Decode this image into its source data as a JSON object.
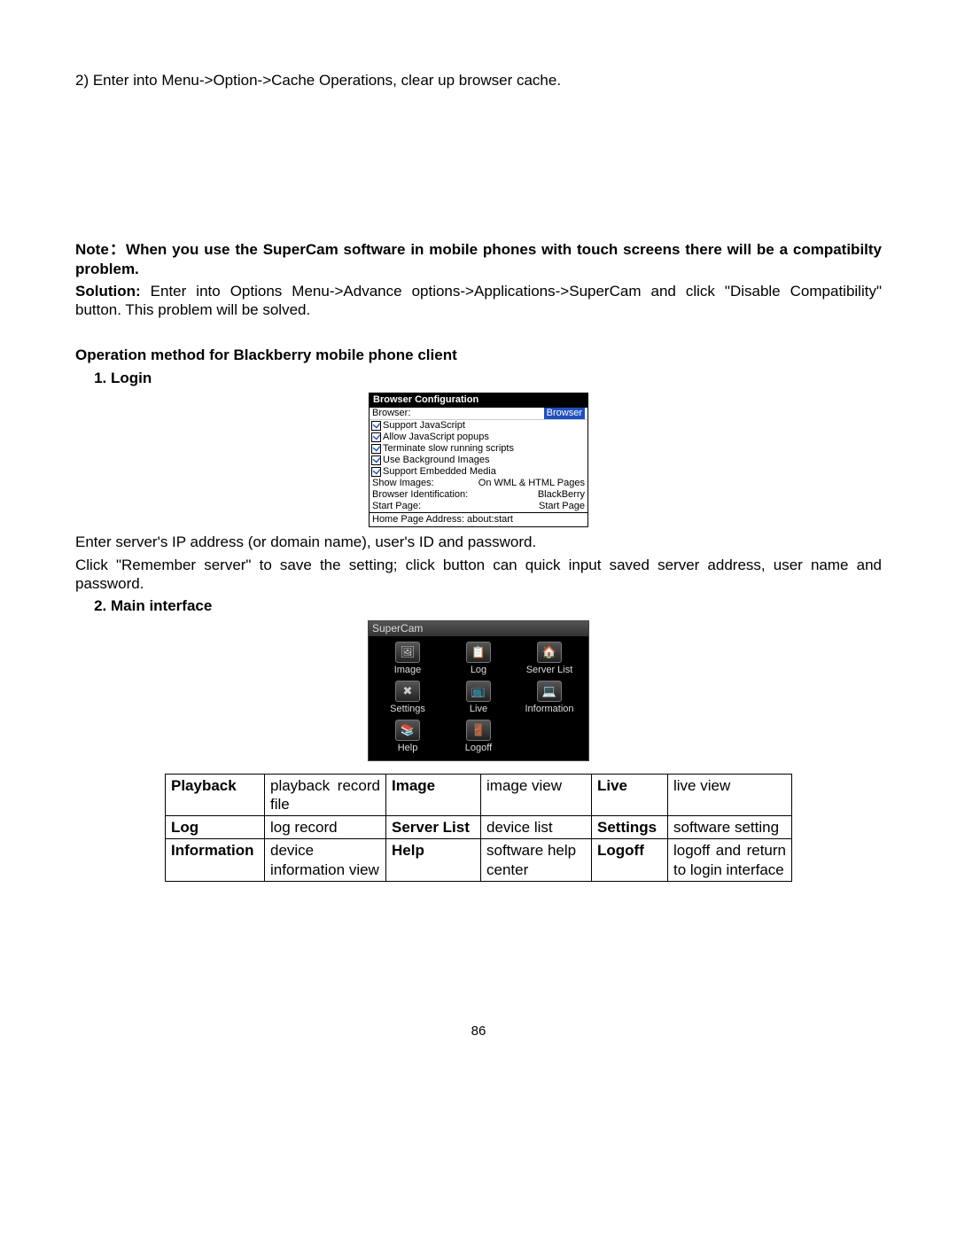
{
  "intro": "2) Enter into Menu->Option->Cache Operations, clear up browser cache.",
  "note_label": "Note：",
  "note_text": "When you use the SuperCam software in mobile phones with touch screens there will be a compatibilty problem.",
  "solution_label": "Solution:",
  "solution_text": " Enter into Options Menu->Advance options->Applications->SuperCam and click \"Disable Compatibility\" button. This problem will be solved.",
  "op_heading": "Operation method for Blackberry mobile phone client",
  "login_item": "Login",
  "bb": {
    "title": "Browser Configuration",
    "browser_label": "Browser:",
    "browser_value": "Browser",
    "chk1": "Support JavaScript",
    "chk2": "Allow JavaScript popups",
    "chk3": "Terminate slow running scripts",
    "chk4": "Use Background Images",
    "chk5": "Support Embedded Media",
    "show_label": "Show Images:",
    "show_value": "On WML & HTML Pages",
    "id_label": "Browser Identification:",
    "id_value": "BlackBerry",
    "start_label": "Start Page:",
    "start_value": "Start Page",
    "home": "Home Page Address: about:start"
  },
  "login_p1": "Enter server's IP address (or domain name), user's ID and password.",
  "login_p2": "Click \"Remember server\" to save the setting; click        button can quick input saved server address, user name and password.",
  "main_item": "Main interface",
  "sc": {
    "title": "SuperCam",
    "items": [
      {
        "label": "Image",
        "glyph": "🖼"
      },
      {
        "label": "Log",
        "glyph": "📋"
      },
      {
        "label": "Server List",
        "glyph": "🏠"
      },
      {
        "label": "Settings",
        "glyph": "✖"
      },
      {
        "label": "Live",
        "glyph": "📺"
      },
      {
        "label": "Information",
        "glyph": "💻"
      },
      {
        "label": "Help",
        "glyph": "📚"
      },
      {
        "label": "Logoff",
        "glyph": "🚪"
      }
    ]
  },
  "table": {
    "r1": {
      "h1": "Playback",
      "d1": "playback record file",
      "h2": "Image",
      "d2": "image view",
      "h3": "Live",
      "d3": "live view"
    },
    "r2": {
      "h1": "Log",
      "d1": "log record",
      "h2": "Server List",
      "d2": "device list",
      "h3": "Settings",
      "d3": "software setting"
    },
    "r3": {
      "h1": "Information",
      "d1": "device information view",
      "h2": "Help",
      "d2": "software help center",
      "h3": "Logoff",
      "d3": "logoff and return to login interface"
    }
  },
  "page_number": "86"
}
